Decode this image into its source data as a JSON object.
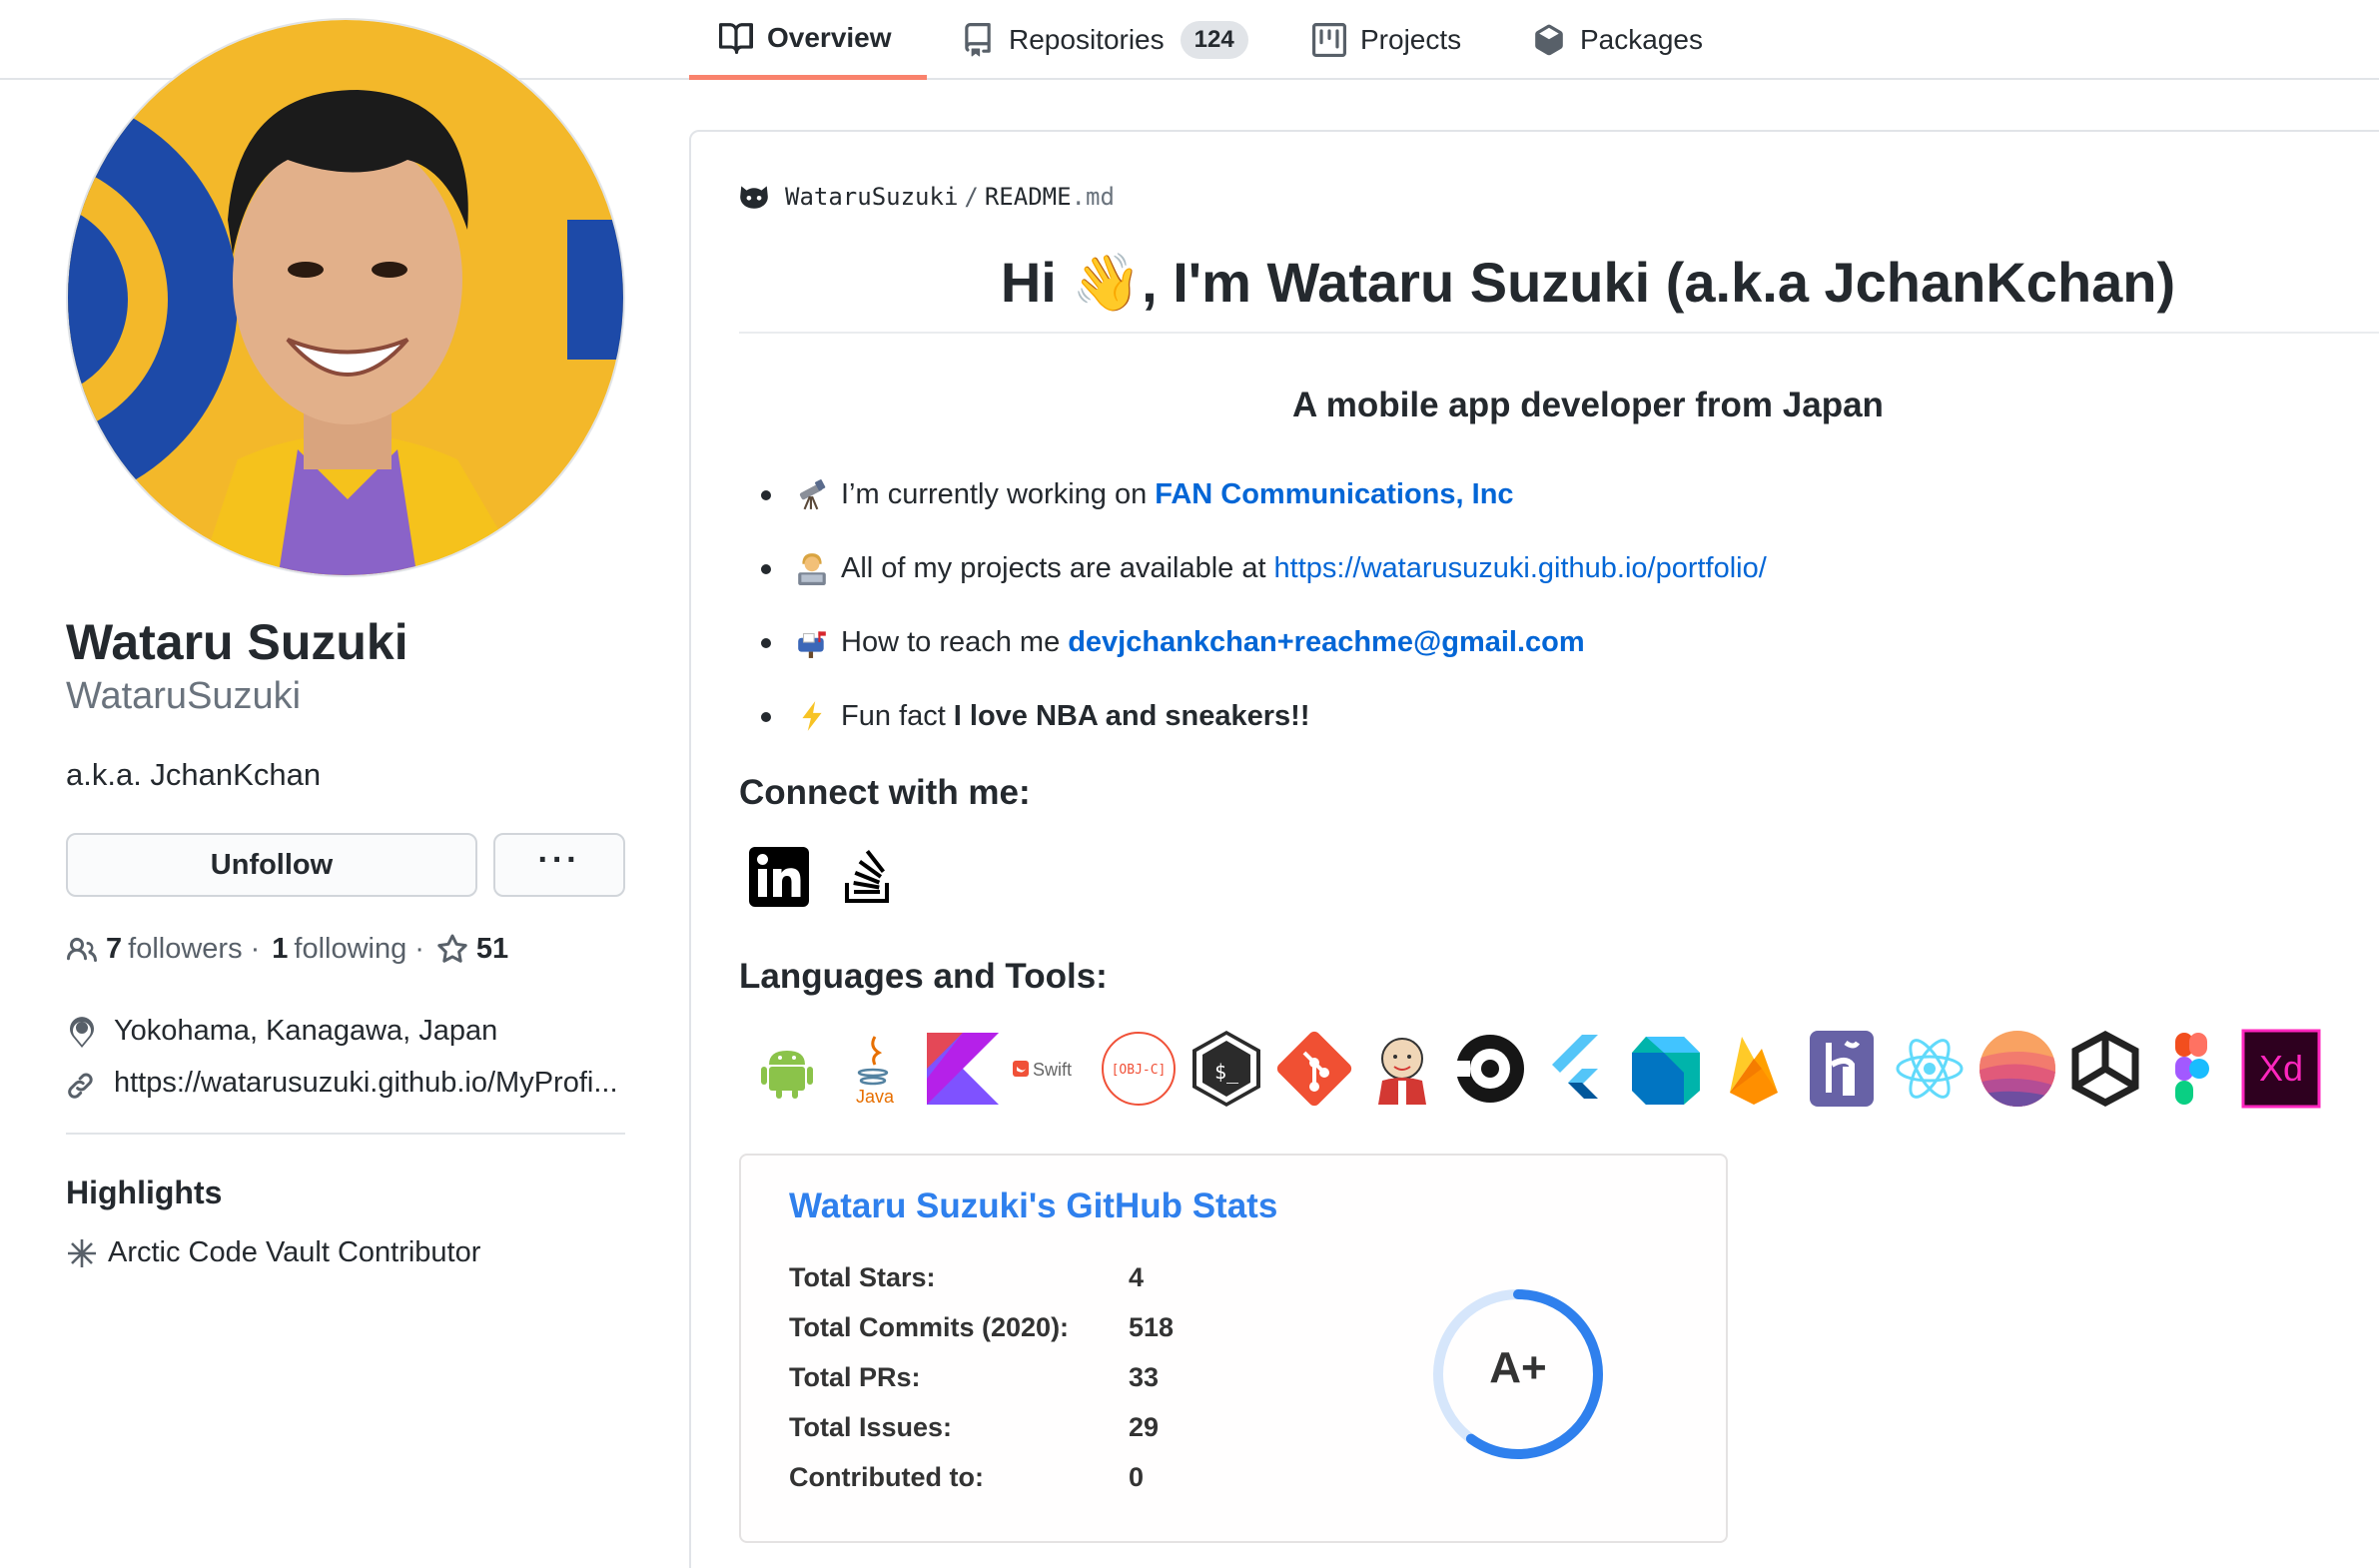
{
  "tabs": [
    {
      "label": "Overview",
      "icon": "book-icon",
      "active": true
    },
    {
      "label": "Repositories",
      "icon": "repo-icon",
      "count": "124"
    },
    {
      "label": "Projects",
      "icon": "project-icon"
    },
    {
      "label": "Packages",
      "icon": "package-icon"
    }
  ],
  "profile": {
    "name": "Wataru Suzuki",
    "login": "WataruSuzuki",
    "bio": "a.k.a. JchanKchan",
    "unfollow_label": "Unfollow",
    "more_label": "···",
    "followers_count": "7",
    "followers_label": "followers",
    "dot1": "·",
    "following_count": "1",
    "following_label": "following",
    "dot2": "·",
    "stars_count": "51",
    "location": "Yokohama, Kanagawa, Japan",
    "website": "https://watarusuzuki.github.io/MyProfi...",
    "highlights_title": "Highlights",
    "highlight_item": "Arctic Code Vault Contributor"
  },
  "readme": {
    "path_owner": "WataruSuzuki",
    "path_slash": "/",
    "path_file": "README",
    "path_ext": ".md",
    "heading": "Hi 👋, I'm Wataru Suzuki (a.k.a JchanKchan)",
    "subheading": "A mobile app developer from Japan",
    "bullets": [
      {
        "emoji": "telescope-icon",
        "text": "I’m currently working on",
        "link": "FAN Communications, Inc"
      },
      {
        "emoji": "technologist-icon",
        "text": "All of my projects are available at",
        "link": "https://watarusuzuki.github.io/portfolio/"
      },
      {
        "emoji": "mailbox-icon",
        "text": "How to reach me",
        "link": "devjchankchan+reachme@gmail.com"
      },
      {
        "emoji": "lightning-icon",
        "text": "Fun fact",
        "strong": "I love NBA and sneakers!!"
      }
    ],
    "connect_title": "Connect with me:",
    "social": [
      "linkedin-icon",
      "stackoverflow-icon"
    ],
    "tools_title": "Languages and Tools:",
    "tools": [
      {
        "name": "android-icon"
      },
      {
        "name": "java-icon",
        "label": "Java"
      },
      {
        "name": "kotlin-icon"
      },
      {
        "name": "swift-icon",
        "label": "Swift"
      },
      {
        "name": "objective-c-icon",
        "label": "[OBJ-C]"
      },
      {
        "name": "bash-icon",
        "label": "$_"
      },
      {
        "name": "git-icon"
      },
      {
        "name": "jenkins-icon"
      },
      {
        "name": "circleci-icon"
      },
      {
        "name": "flutter-icon"
      },
      {
        "name": "dart-icon"
      },
      {
        "name": "firebase-icon"
      },
      {
        "name": "heroku-icon"
      },
      {
        "name": "react-icon"
      },
      {
        "name": "realm-icon"
      },
      {
        "name": "unity-icon"
      },
      {
        "name": "figma-icon"
      },
      {
        "name": "xd-icon",
        "label": "Xd"
      }
    ],
    "stats": {
      "title": "Wataru Suzuki's GitHub Stats",
      "rows": [
        {
          "label": "Total Stars:",
          "value": "4"
        },
        {
          "label": "Total Commits (2020):",
          "value": "518"
        },
        {
          "label": "Total PRs:",
          "value": "33"
        },
        {
          "label": "Total Issues:",
          "value": "29"
        },
        {
          "label": "Contributed to:",
          "value": "0"
        }
      ],
      "grade": "A+",
      "grade_progress": 0.6
    }
  },
  "colors": {
    "link": "#0366d6",
    "accent_tab": "#f9826c",
    "stats_title": "#2f80ed"
  }
}
